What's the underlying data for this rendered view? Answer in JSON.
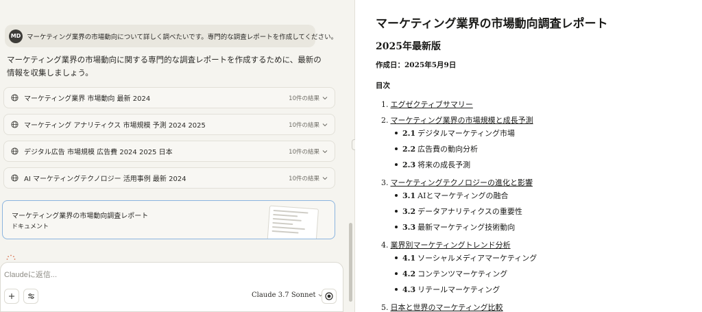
{
  "chat": {
    "user_avatar": "MD",
    "user_message": "マーケティング業界の市場動向について詳しく調べたいです。専門的な調査レポートを作成してください。",
    "assistant_message": "マーケティング業界の市場動向に関する専門的な調査レポートを作成するために、最新の情報を収集しましょう。",
    "searches": [
      {
        "query": "マーケティング業界 市場動向 最新 2024",
        "results": "10件の結果"
      },
      {
        "query": "マーケティング アナリティクス 市場規模 予測 2024 2025",
        "results": "10件の結果"
      },
      {
        "query": "デジタル広告 市場規模 広告費 2024 2025 日本",
        "results": "10件の結果"
      },
      {
        "query": "AI マーケティングテクノロジー 活用事例 最新 2024",
        "results": "10件の結果"
      }
    ],
    "document_card": {
      "title": "マーケティング業界の市場動向調査レポート",
      "type": "ドキュメント"
    },
    "composer": {
      "placeholder": "Claudeに返信...",
      "model": "Claude 3.7 Sonnet"
    },
    "icons": {
      "search": "globe-icon",
      "expand": "chevron-down-icon",
      "add": "plus-icon",
      "tools": "sliders-icon",
      "record": "record-icon"
    }
  },
  "report": {
    "title": "マーケティング業界の市場動向調査レポート",
    "subtitle": "2025年最新版",
    "date": "作成日：2025年5月9日",
    "toc_heading": "目次",
    "toc": [
      {
        "num": "1.",
        "label": "エグゼクティブサマリー",
        "subs": []
      },
      {
        "num": "2.",
        "label": "マーケティング業界の市場規模と成長予測",
        "subs": [
          {
            "num": "2.1",
            "label": "デジタルマーケティング市場"
          },
          {
            "num": "2.2",
            "label": "広告費の動向分析"
          },
          {
            "num": "2.3",
            "label": "将来の成長予測"
          }
        ]
      },
      {
        "num": "3.",
        "label": "マーケティングテクノロジーの進化と影響",
        "subs": [
          {
            "num": "3.1",
            "label": "AIとマーケティングの融合"
          },
          {
            "num": "3.2",
            "label": "データアナリティクスの重要性"
          },
          {
            "num": "3.3",
            "label": "最新マーケティング技術動向"
          }
        ]
      },
      {
        "num": "4.",
        "label": "業界別マーケティングトレンド分析",
        "subs": [
          {
            "num": "4.1",
            "label": "ソーシャルメディアマーケティング"
          },
          {
            "num": "4.2",
            "label": "コンテンツマーケティング"
          },
          {
            "num": "4.3",
            "label": "リテールマーケティング"
          }
        ]
      },
      {
        "num": "5.",
        "label": "日本と世界のマーケティング比較",
        "subs": []
      }
    ]
  }
}
